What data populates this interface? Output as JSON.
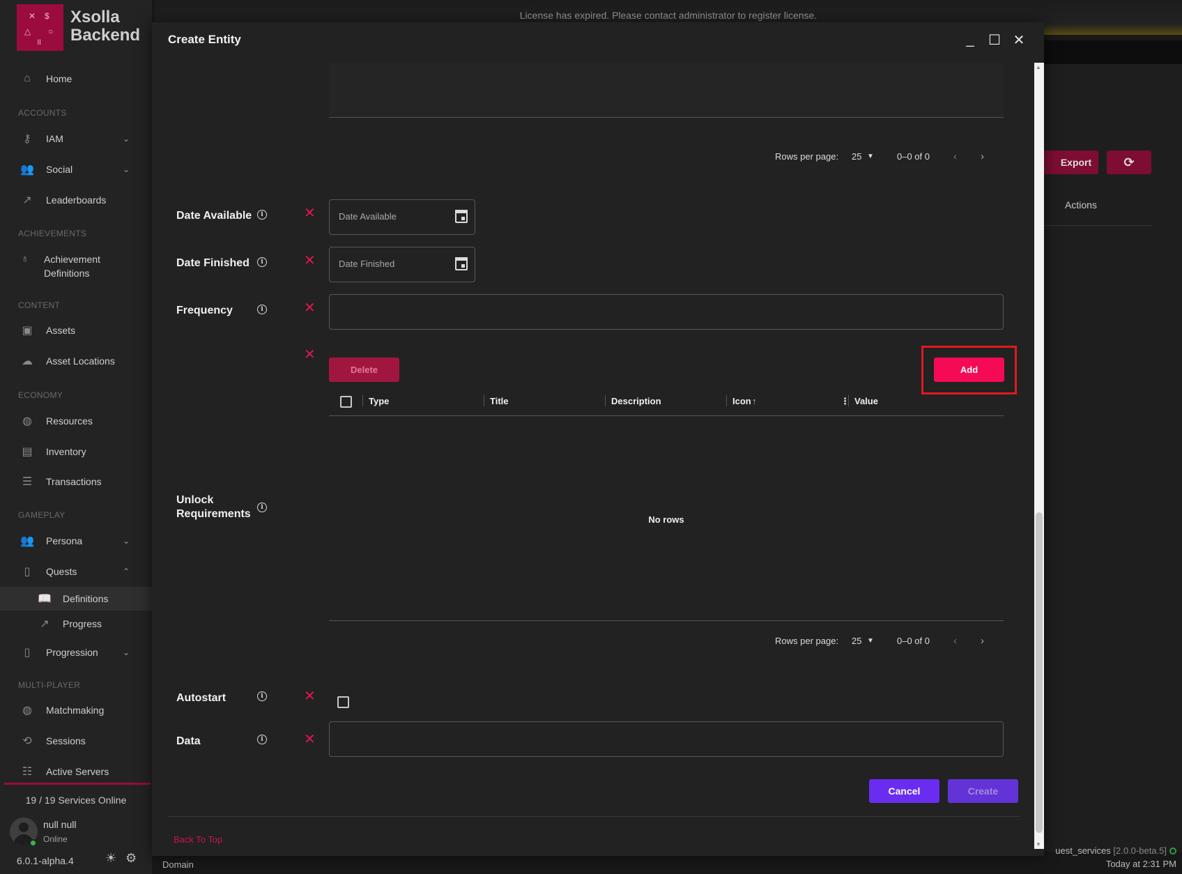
{
  "license_banner": "License has expired. Please contact administrator to register license.",
  "sidebar": {
    "logo": {
      "glyphs": [
        "✕",
        "$",
        "△",
        "○",
        "॥"
      ],
      "line1": "Xsolla",
      "line2": "Backend"
    },
    "home": "Home",
    "sections": {
      "accounts": "ACCOUNTS",
      "achievements": "ACHIEVEMENTS",
      "content": "CONTENT",
      "economy": "ECONOMY",
      "gameplay": "GAMEPLAY",
      "multiplayer": "MULTI-PLAYER"
    },
    "items": {
      "iam": "IAM",
      "social": "Social",
      "leaderboards": "Leaderboards",
      "achievement_definitions_1": "Achievement",
      "achievement_definitions_2": "Definitions",
      "assets": "Assets",
      "asset_locations": "Asset Locations",
      "resources": "Resources",
      "inventory": "Inventory",
      "transactions": "Transactions",
      "persona": "Persona",
      "quests": "Quests",
      "definitions": "Definitions",
      "progress": "Progress",
      "progression": "Progression",
      "matchmaking": "Matchmaking",
      "sessions": "Sessions",
      "active_servers": "Active Servers"
    },
    "services_online": "19 / 19 Services Online",
    "user_name": "null null",
    "user_status": "Online",
    "version": "6.0.1-alpha.4"
  },
  "background": {
    "export_label": "Export",
    "actions_header": "Actions",
    "status_service": "uest_services",
    "status_version": "[2.0.0-beta.5]",
    "status_time": "Today at 2:31 PM",
    "footer_domain": "Domain"
  },
  "dialog": {
    "title": "Create Entity",
    "pager_top": {
      "rows_per_page_label": "Rows per page:",
      "rows_per_page": "25",
      "range": "0–0 of 0"
    },
    "fields": {
      "date_available": {
        "label": "Date Available",
        "placeholder": "Date Available"
      },
      "date_finished": {
        "label": "Date Finished",
        "placeholder": "Date Finished"
      },
      "frequency": {
        "label": "Frequency"
      },
      "unlock_requirements": {
        "label_line1": "Unlock",
        "label_line2": "Requirements"
      },
      "autostart": {
        "label": "Autostart"
      },
      "data": {
        "label": "Data"
      }
    },
    "delete_label": "Delete",
    "add_label": "Add",
    "grid": {
      "columns": [
        "Type",
        "Title",
        "Description",
        "Icon",
        "Value"
      ],
      "empty_text": "No rows"
    },
    "pager_bottom": {
      "rows_per_page_label": "Rows per page:",
      "rows_per_page": "25",
      "range": "0–0 of 0"
    },
    "cancel_label": "Cancel",
    "create_label": "Create",
    "back_to_top": "Back To Top"
  }
}
